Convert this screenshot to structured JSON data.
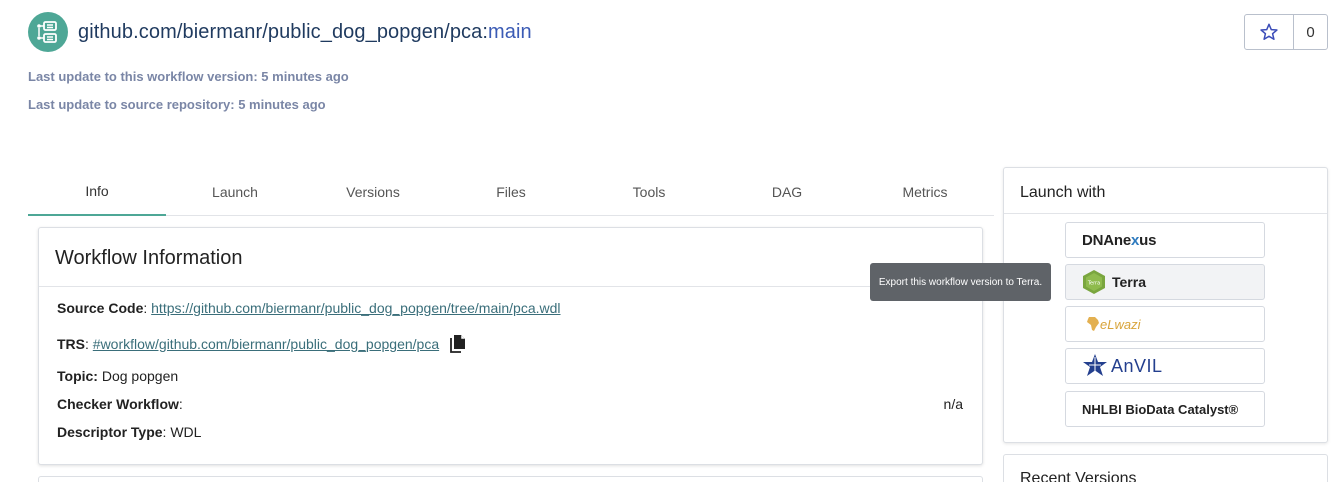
{
  "header": {
    "title_prefix": "github.com/biermanr/public_dog_popgen/pca:",
    "branch": "main",
    "logo_icon": "workflow-icon"
  },
  "meta": {
    "workflow_update": "Last update to this workflow version: 5 minutes ago",
    "source_update": "Last update to source repository: 5 minutes ago"
  },
  "star": {
    "icon": "star-icon",
    "count": "0"
  },
  "tabs": [
    {
      "label": "Info",
      "active": true
    },
    {
      "label": "Launch"
    },
    {
      "label": "Versions"
    },
    {
      "label": "Files"
    },
    {
      "label": "Tools"
    },
    {
      "label": "DAG"
    },
    {
      "label": "Metrics"
    }
  ],
  "workflow_info": {
    "title": "Workflow Information",
    "source_code_label": "Source Code",
    "source_code_link": "https://github.com/biermanr/public_dog_popgen/tree/main/pca.wdl",
    "trs_label": "TRS",
    "trs_link": "#workflow/github.com/biermanr/public_dog_popgen/pca",
    "topic_label": "Topic:",
    "topic_value": "Dog popgen",
    "checker_label": "Checker Workflow",
    "checker_value": "n/a",
    "descriptor_label": "Descriptor Type",
    "descriptor_value": "WDL"
  },
  "launch_with": {
    "title": "Launch with",
    "dnanexus_pre": "DNAne",
    "dnanexus_x": "x",
    "dnanexus_post": "us",
    "terra": "Terra",
    "terra_badge": "Terra",
    "elwazi": "eLwazi",
    "anvil": "AnVIL",
    "nhlbi": "NHLBI BioData Catalyst®"
  },
  "tooltip": "Export this workflow version to Terra.",
  "recent_versions": {
    "title": "Recent Versions"
  },
  "colors": {
    "accent": "#4ea796",
    "link": "#3a6e7a",
    "branch": "#3b5bb5",
    "meta_text": "#7a86a6"
  }
}
